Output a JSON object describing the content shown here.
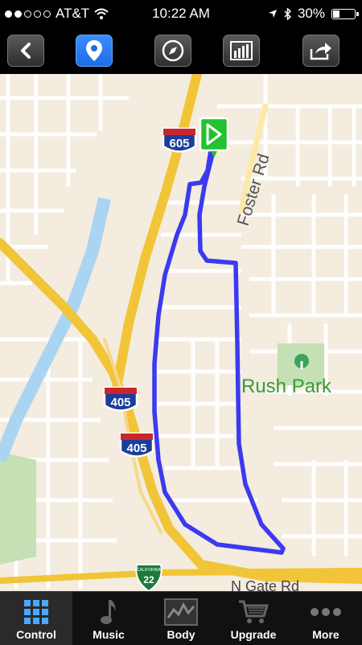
{
  "status": {
    "carrier": "AT&T",
    "time": "10:22 AM",
    "battery_percent": 30,
    "battery_label": "30%",
    "signal_bars_filled": 2,
    "signal_bars_total": 5
  },
  "toolbar": {
    "buttons": [
      {
        "name": "back",
        "icon": "chevron-left-icon"
      },
      {
        "name": "map",
        "icon": "location-pin-icon",
        "active": true
      },
      {
        "name": "compass",
        "icon": "compass-icon"
      },
      {
        "name": "stats",
        "icon": "bar-chart-icon"
      },
      {
        "name": "share",
        "icon": "share-arrow-icon"
      }
    ]
  },
  "map": {
    "labels": {
      "foster_rd": "Foster Rd",
      "rush_park": "Rush Park",
      "n_gate_rd": "N Gate Rd"
    },
    "shields": {
      "i605": "605",
      "i405_upper": "405",
      "i405_lower": "405",
      "ca22_header": "CALIFORNIA",
      "ca22": "22"
    },
    "route_color": "#3a3af0",
    "start_marker_color": "#22c32e"
  },
  "tabs": [
    {
      "label": "Control",
      "icon": "grid-icon",
      "active": true
    },
    {
      "label": "Music",
      "icon": "music-note-icon"
    },
    {
      "label": "Body",
      "icon": "heart-graph-icon"
    },
    {
      "label": "Upgrade",
      "icon": "cart-icon"
    },
    {
      "label": "More",
      "icon": "more-dots-icon"
    }
  ]
}
